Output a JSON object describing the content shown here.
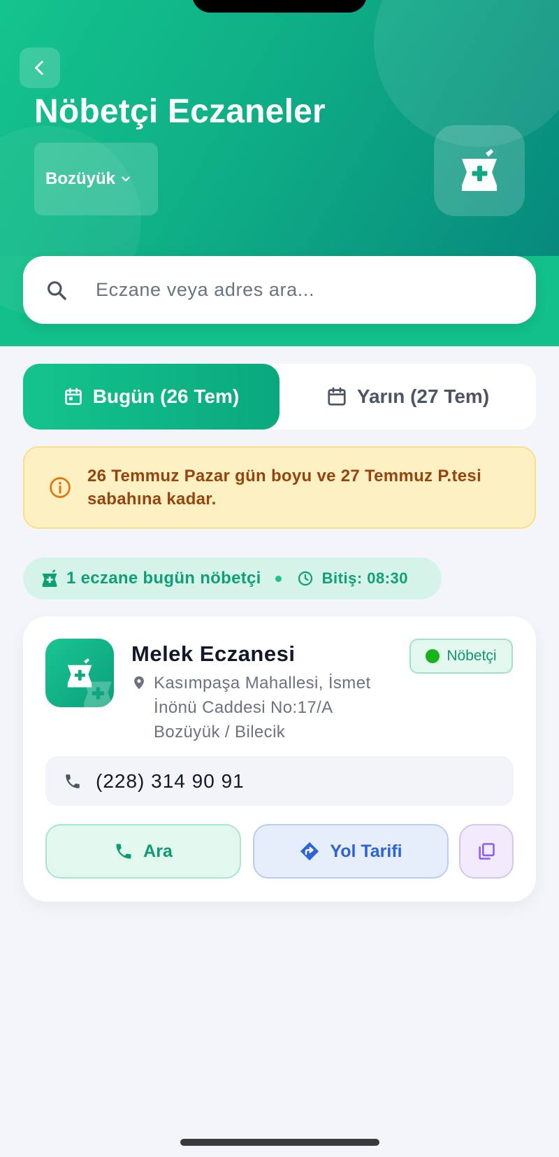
{
  "header": {
    "title": "Nöbetçi Eczaneler",
    "city": "Bozüyük",
    "back_icon": "chevron-left-icon",
    "logo_icon": "mortar-pestle-plus-icon"
  },
  "search": {
    "placeholder": "Eczane veya adres ara...",
    "value": ""
  },
  "tabs": [
    {
      "label": "Bugün (26 Tem)",
      "active": true
    },
    {
      "label": "Yarın (27 Tem)",
      "active": false
    }
  ],
  "info_banner": {
    "text": "26 Temmuz Pazar gün boyu ve 27 Temmuz P.tesi sabahına kadar."
  },
  "summary": {
    "count_text": "1 eczane bugün nöbetçi",
    "end_text": "Bitiş: 08:30"
  },
  "pharmacies": [
    {
      "name": "Melek Eczanesi",
      "address": "Kasımpaşa Mahallesi, İsmet İnönü Caddesi No:17/A Bozüyük / Bilecik",
      "status": "Nöbetçi",
      "phone": "(228) 314 90 91",
      "call_label": "Ara",
      "route_label": "Yol Tarifi"
    }
  ],
  "colors": {
    "brand": "#12c08a",
    "brand_dark": "#07897d",
    "warning_bg": "#fdf1c4",
    "warning_text": "#96430e",
    "route_blue": "#2c63d8",
    "copy_purple": "#8b5cf6",
    "status_green": "#16b31a"
  }
}
